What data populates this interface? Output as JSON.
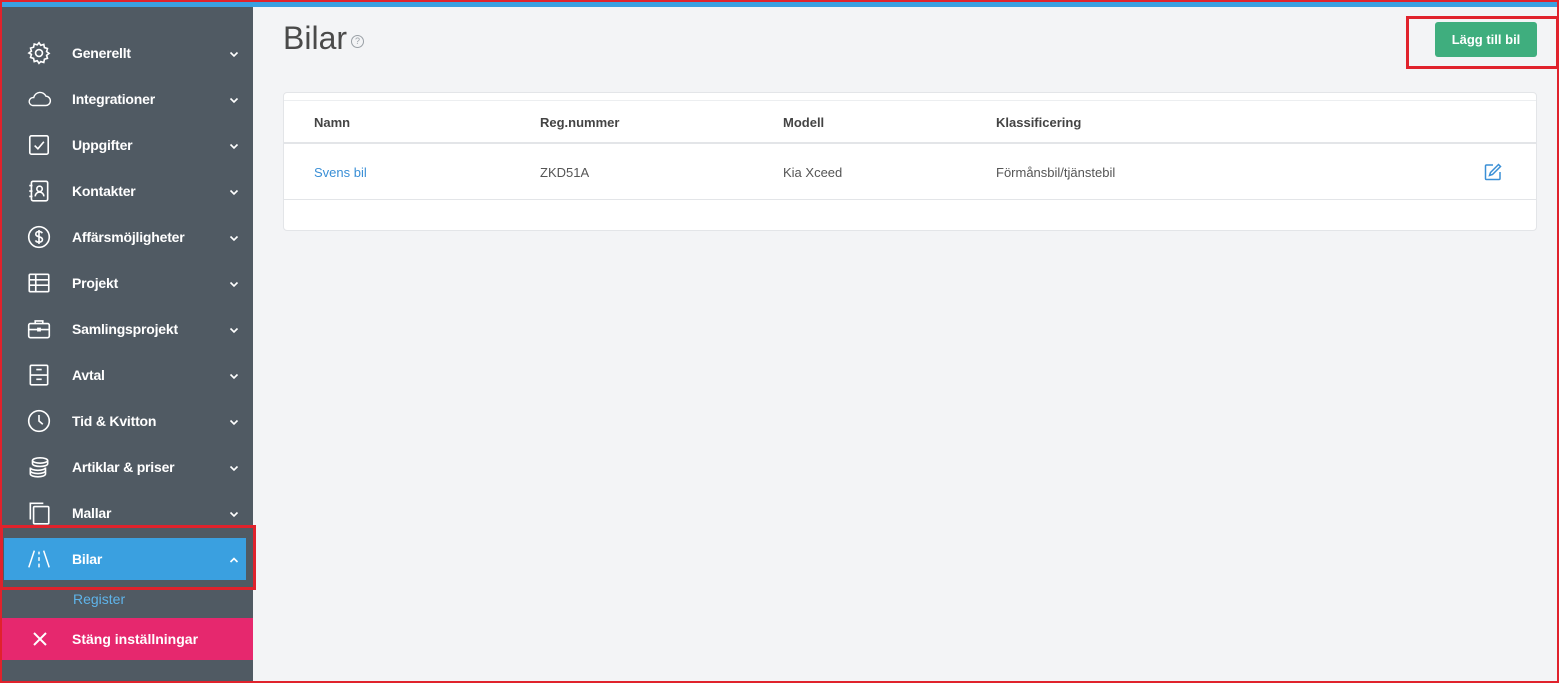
{
  "colors": {
    "sidebar_bg": "#505a63",
    "accent_blue": "#3aa0e0",
    "close_pink": "#e6286e",
    "add_green": "#3fae7e",
    "highlight_red": "#e0222c",
    "link_blue": "#3a8fd6"
  },
  "sidebar": {
    "items": [
      {
        "label": "Generellt",
        "icon": "gear-icon"
      },
      {
        "label": "Integrationer",
        "icon": "cloud-icon"
      },
      {
        "label": "Uppgifter",
        "icon": "checkbox-icon"
      },
      {
        "label": "Kontakter",
        "icon": "contact-card-icon"
      },
      {
        "label": "Affärsmöjligheter",
        "icon": "dollar-circle-icon"
      },
      {
        "label": "Projekt",
        "icon": "table-icon"
      },
      {
        "label": "Samlingsprojekt",
        "icon": "briefcase-icon"
      },
      {
        "label": "Avtal",
        "icon": "archive-drawer-icon"
      },
      {
        "label": "Tid & Kvitton",
        "icon": "clock-icon"
      },
      {
        "label": "Artiklar & priser",
        "icon": "coin-stack-icon"
      },
      {
        "label": "Mallar",
        "icon": "copy-pages-icon"
      },
      {
        "label": "Bilar",
        "icon": "road-icon",
        "active": true
      }
    ],
    "sub_item": "Register",
    "close_label": "Stäng inställningar"
  },
  "page": {
    "title": "Bilar",
    "help": "?",
    "add_button": "Lägg till bil"
  },
  "table": {
    "headers": [
      "Namn",
      "Reg.nummer",
      "Modell",
      "Klassificering"
    ],
    "rows": [
      {
        "name": "Svens bil",
        "reg": "ZKD51A",
        "model": "Kia Xceed",
        "class": "Förmånsbil/tjänstebil"
      }
    ]
  }
}
